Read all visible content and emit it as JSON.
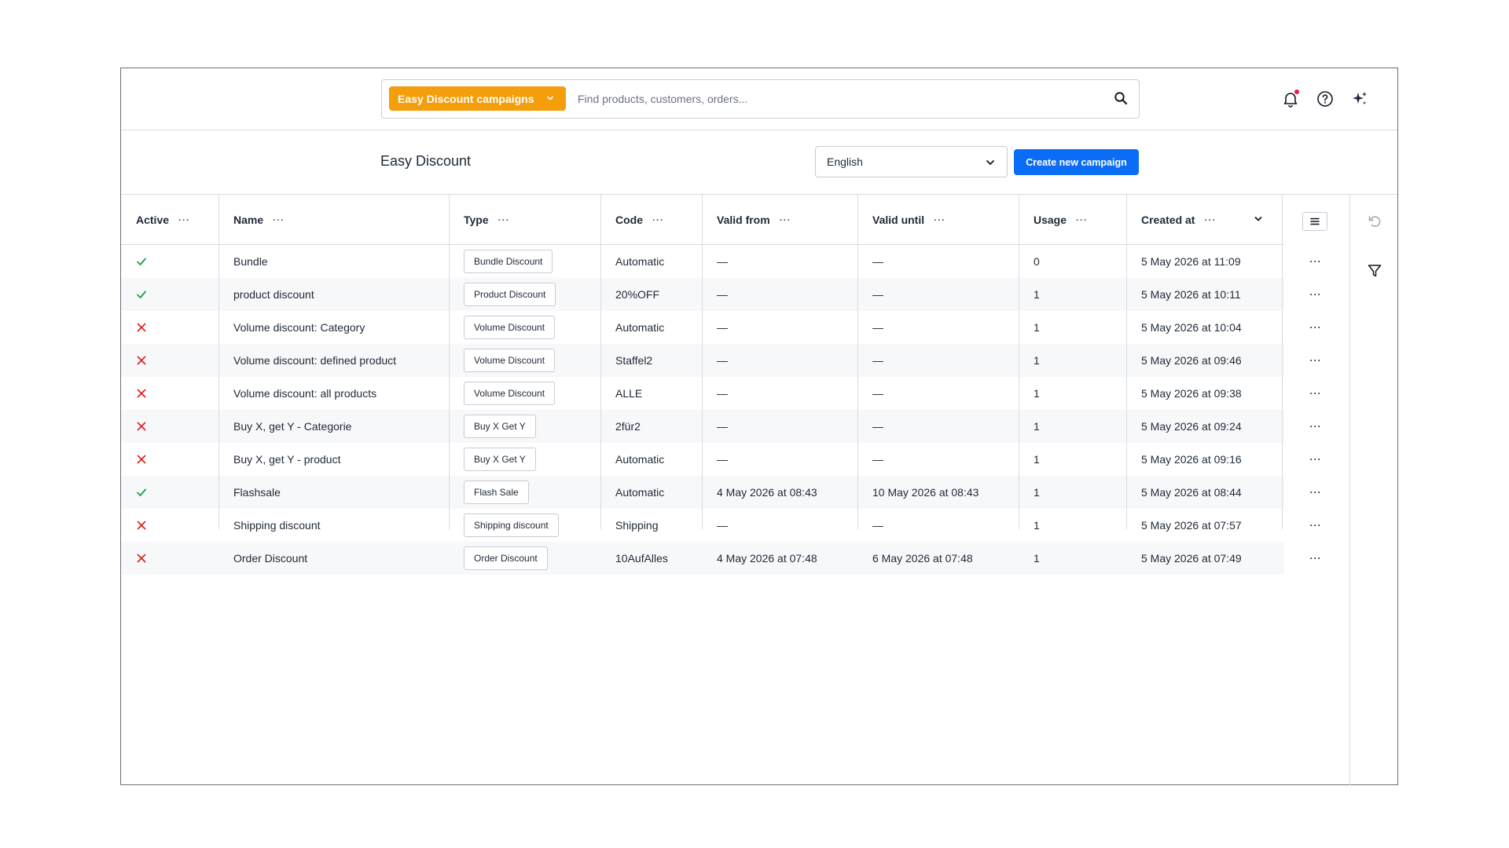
{
  "topbar": {
    "context_button": "Easy Discount campaigns",
    "search_placeholder": "Find products, customers, orders..."
  },
  "header": {
    "title": "Easy Discount",
    "language": "English",
    "create_button": "Create new campaign"
  },
  "table": {
    "columns": [
      {
        "label": "Active"
      },
      {
        "label": "Name"
      },
      {
        "label": "Type"
      },
      {
        "label": "Code"
      },
      {
        "label": "Valid from"
      },
      {
        "label": "Valid until"
      },
      {
        "label": "Usage"
      },
      {
        "label": "Created at"
      }
    ],
    "rows": [
      {
        "active": true,
        "name": "Bundle",
        "type": "Bundle Discount",
        "code": "Automatic",
        "valid_from": "—",
        "valid_until": "—",
        "usage": "0",
        "created_at": "5 May 2026 at 11:09"
      },
      {
        "active": true,
        "name": "product discount",
        "type": "Product Discount",
        "code": "20%OFF",
        "valid_from": "—",
        "valid_until": "—",
        "usage": "1",
        "created_at": "5 May 2026 at 10:11"
      },
      {
        "active": false,
        "name": "Volume discount: Category",
        "type": "Volume Discount",
        "code": "Automatic",
        "valid_from": "—",
        "valid_until": "—",
        "usage": "1",
        "created_at": "5 May 2026 at 10:04"
      },
      {
        "active": false,
        "name": "Volume discount: defined product",
        "type": "Volume Discount",
        "code": "Staffel2",
        "valid_from": "—",
        "valid_until": "—",
        "usage": "1",
        "created_at": "5 May 2026 at 09:46"
      },
      {
        "active": false,
        "name": "Volume discount: all products",
        "type": "Volume Discount",
        "code": "ALLE",
        "valid_from": "—",
        "valid_until": "—",
        "usage": "1",
        "created_at": "5 May 2026 at 09:38"
      },
      {
        "active": false,
        "name": "Buy X, get Y - Categorie",
        "type": "Buy X Get Y",
        "code": "2für2",
        "valid_from": "—",
        "valid_until": "—",
        "usage": "1",
        "created_at": "5 May 2026 at 09:24"
      },
      {
        "active": false,
        "name": "Buy X, get Y - product",
        "type": "Buy X Get Y",
        "code": "Automatic",
        "valid_from": "—",
        "valid_until": "—",
        "usage": "1",
        "created_at": "5 May 2026 at 09:16"
      },
      {
        "active": true,
        "name": "Flashsale",
        "type": "Flash Sale",
        "code": "Automatic",
        "valid_from": "4 May 2026 at 08:43",
        "valid_until": "10 May 2026 at 08:43",
        "usage": "1",
        "created_at": "5 May 2026 at 08:44"
      },
      {
        "active": false,
        "name": "Shipping discount",
        "type": "Shipping discount",
        "code": "Shipping",
        "valid_from": "—",
        "valid_until": "—",
        "usage": "1",
        "created_at": "5 May 2026 at 07:57"
      },
      {
        "active": false,
        "name": "Order Discount",
        "type": "Order Discount",
        "code": "10AufAlles",
        "valid_from": "4 May 2026 at 07:48",
        "valid_until": "6 May 2026 at 07:48",
        "usage": "1",
        "created_at": "5 May 2026 at 07:49"
      }
    ]
  },
  "icons": {
    "search": "search-icon",
    "notifications": "bell-icon",
    "help": "help-icon",
    "ai": "sparkles-icon",
    "active": "check-icon",
    "inactive": "cross-icon",
    "undo": "undo-icon",
    "filter": "filter-icon"
  },
  "colors": {
    "accent_orange": "#f59e0b",
    "primary_blue": "#0b6cf5",
    "active_green": "#16a34a",
    "inactive_red": "#dc2626",
    "notification_dot": "#e11d48"
  }
}
